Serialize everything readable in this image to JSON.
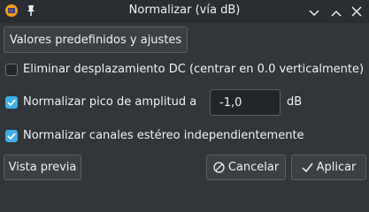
{
  "window": {
    "title": "Normalizar (vía dB)"
  },
  "toolbar": {
    "presets_label": "Valores predefinidos y ajustes"
  },
  "options": {
    "dc_offset": {
      "label": "Eliminar desplazamiento DC (centrar en 0.0 verticalmente)",
      "checked": false
    },
    "normalize_peak": {
      "label": "Normalizar pico de amplitud a",
      "checked": true,
      "value": "-1,0",
      "unit": "dB"
    },
    "stereo_independent": {
      "label": "Normalizar canales estéreo independientemente",
      "checked": true
    }
  },
  "footer": {
    "preview_label": "Vista previa",
    "cancel_label": "Cancelar",
    "apply_label": "Aplicar"
  },
  "colors": {
    "accent": "#3daee9",
    "background": "#31363b"
  }
}
